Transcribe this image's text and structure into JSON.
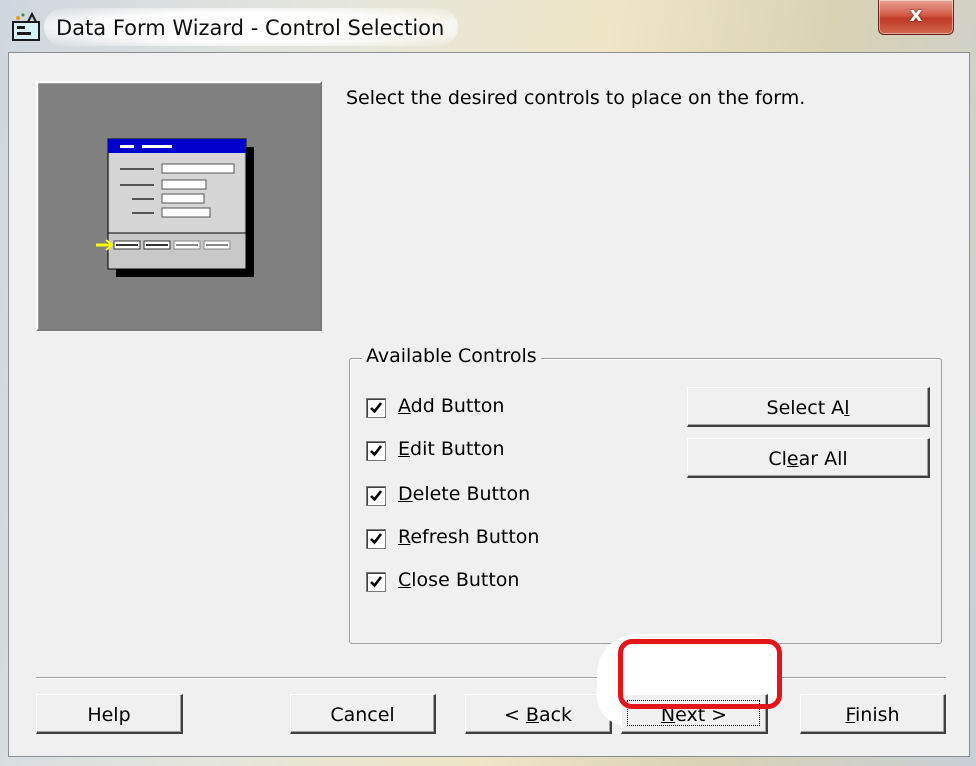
{
  "window": {
    "title": "Data Form Wizard - Control Selection",
    "close_label": "x",
    "colors": {
      "frame_accent": "#efe6c6",
      "client_bg": "#f0f0f0",
      "close_red": "#c9432c",
      "highlight_red": "#e3141a",
      "preview_blue": "#0000cc"
    }
  },
  "main": {
    "instruction": "Select the desired controls to place on the form."
  },
  "controls_group": {
    "legend": "Available Controls",
    "items": [
      {
        "pre": "",
        "accel": "A",
        "post": "dd Button",
        "checked": true
      },
      {
        "pre": "",
        "accel": "E",
        "post": "dit Button",
        "checked": true
      },
      {
        "pre": "",
        "accel": "D",
        "post": "elete Button",
        "checked": true
      },
      {
        "pre": "",
        "accel": "R",
        "post": "efresh Button",
        "checked": true
      },
      {
        "pre": "",
        "accel": "C",
        "post": "lose Button",
        "checked": true
      }
    ],
    "select_all": {
      "pre": "Select A",
      "accel": "l",
      "post": ""
    },
    "clear_all": {
      "pre": "Cl",
      "accel": "e",
      "post": "ar All"
    }
  },
  "footer": {
    "help": "Help",
    "cancel": "Cancel",
    "back": {
      "pre": "< ",
      "accel": "B",
      "post": "ack"
    },
    "next": {
      "pre": "",
      "accel": "N",
      "post": "ext >"
    },
    "finish": {
      "pre": "",
      "accel": "F",
      "post": "inish"
    }
  },
  "icons": [
    "app-icon",
    "check-icon",
    "close-icon",
    "form-preview-image"
  ]
}
